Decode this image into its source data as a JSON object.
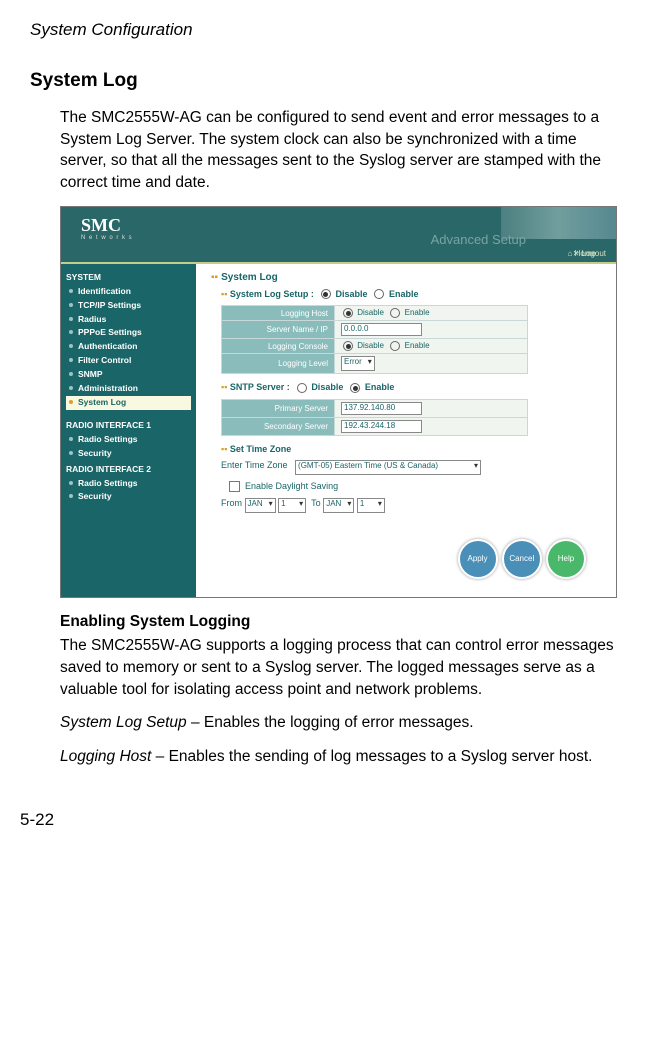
{
  "page": {
    "chapter_title": "System Configuration",
    "section_title": "System Log",
    "intro": "The SMC2555W-AG can be configured to send event and error messages to a System Log Server. The system clock can also be synchronized with a time server, so that all the messages sent to the Syslog server are stamped with the correct time and date.",
    "subsection_title": "Enabling System Logging",
    "subsection_text": "The SMC2555W-AG supports a logging process that can control error messages saved to memory or sent to a Syslog server. The logged messages serve as a valuable tool for isolating access point and network problems.",
    "param1_name": "System Log Setup",
    "param1_desc": " – Enables the logging of error messages.",
    "param2_name": "Logging Host",
    "param2_desc": " – Enables the sending of log messages to a Syslog server host.",
    "page_number": "5-22"
  },
  "screenshot": {
    "logo": "SMC",
    "logo_sub": "N e t w o r k s",
    "advanced": "Advanced Setup",
    "home": "⌂ Home",
    "logout": "✕ Logout",
    "nav": {
      "system": "SYSTEM",
      "items1": [
        "Identification",
        "TCP/IP Settings",
        "Radius",
        "PPPoE Settings",
        "Authentication",
        "Filter Control",
        "SNMP",
        "Administration",
        "System Log"
      ],
      "radio1": "RADIO INTERFACE 1",
      "items2": [
        "Radio Settings",
        "Security"
      ],
      "radio2": "RADIO INTERFACE 2",
      "items3": [
        "Radio Settings",
        "Security"
      ]
    },
    "content": {
      "h1": "System Log",
      "setup_label": "System Log Setup  :",
      "disable": "Disable",
      "enable": "Enable",
      "logging_host": "Logging Host",
      "server_ip": "Server Name / IP",
      "server_ip_val": "0.0.0.0",
      "logging_console": "Logging Console",
      "logging_level": "Logging Level",
      "logging_level_val": "Error",
      "sntp": "SNTP Server  :",
      "primary": "Primary Server",
      "primary_val": "137.92.140.80",
      "secondary": "Secondary Server",
      "secondary_val": "192.43.244.18",
      "timezone_h": "Set Time Zone",
      "entertz": "Enter Time Zone",
      "tz_val": "(GMT-05) Eastern Time (US & Canada)",
      "dst": "Enable Daylight Saving",
      "from": "From",
      "to": "To",
      "jan": "JAN",
      "one": "1",
      "apply": "Apply",
      "cancel": "Cancel",
      "help": "Help"
    }
  }
}
